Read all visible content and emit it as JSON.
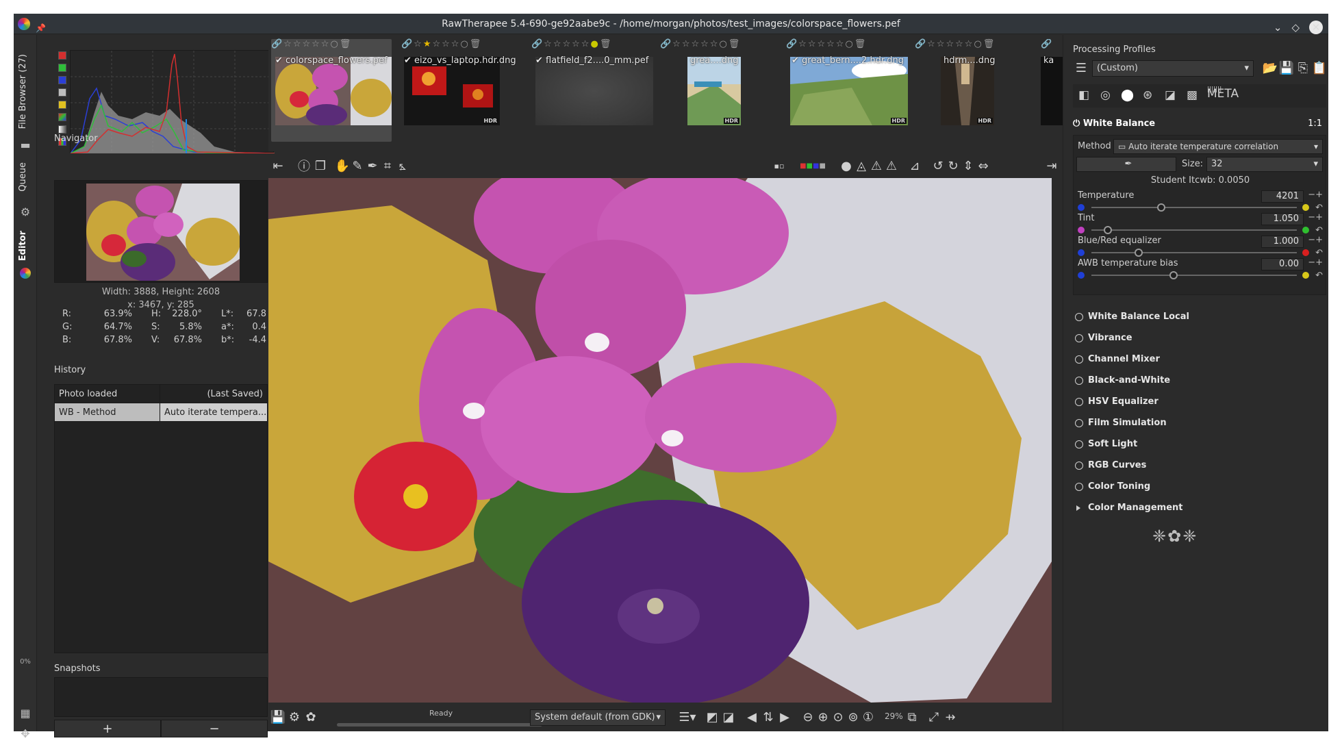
{
  "window": {
    "title": "RawTherapee 5.4-690-ge92aabe9c - /home/morgan/photos/test_images/colorspace_flowers.pef"
  },
  "vtabs": {
    "file_browser": "File Browser (27)",
    "queue": "Queue",
    "editor": "Editor",
    "progress": "0%"
  },
  "navigator": {
    "title": "Navigator",
    "size": "Width: 3888, Height: 2608",
    "coords": "x: 3467, y: 285",
    "stats": [
      {
        "k1": "R:",
        "v1": "63.9%",
        "k2": "H:",
        "v2": "228.0°",
        "k3": "L*:",
        "v3": "67.8"
      },
      {
        "k1": "G:",
        "v1": "64.7%",
        "k2": "S:",
        "v2": "5.8%",
        "k3": "a*:",
        "v3": "0.4"
      },
      {
        "k1": "B:",
        "v1": "67.8%",
        "k2": "V:",
        "v2": "67.8%",
        "k3": "b*:",
        "v3": "-4.4"
      }
    ]
  },
  "history": {
    "title": "History",
    "header": {
      "a": "Photo loaded",
      "b": "(Last Saved)"
    },
    "rows": [
      {
        "a": "WB - Method",
        "b": "Auto iterate tempera..."
      }
    ]
  },
  "snapshots": {
    "title": "Snapshots",
    "add": "+",
    "remove": "−"
  },
  "filmstrip": {
    "items": [
      {
        "name": "colorspace_flowers.pef",
        "hdr": ""
      },
      {
        "name": "eizo_vs_laptop.hdr.dng",
        "hdr": "HDR"
      },
      {
        "name": "flatfield_f2....0_mm.pef",
        "hdr": ""
      },
      {
        "name": "grea....dng",
        "hdr": "HDR"
      },
      {
        "name": "great_bern....2.hdr.dng",
        "hdr": "HDR"
      },
      {
        "name": "hdrm....dng",
        "hdr": "HDR"
      },
      {
        "name": "ka",
        "hdr": ""
      }
    ]
  },
  "bottombar": {
    "status": "Ready",
    "output_profile": "System default (from GDK)",
    "zoom": "29%"
  },
  "right": {
    "title": "Processing Profiles",
    "profile": "(Custom)",
    "wb": {
      "title": "White Balance",
      "ratio": "1:1",
      "method_label": "Method",
      "method_value": "Auto iterate temperature correlation",
      "size_label": "Size:",
      "size_value": "32",
      "student": "Student Itcwb: 0.0050",
      "sliders": [
        {
          "label": "Temperature",
          "value": "4201",
          "pos": 0.34,
          "lcolor": "#1f3fd6",
          "rcolor": "#d8c81a"
        },
        {
          "label": "Tint",
          "value": "1.050",
          "pos": 0.08,
          "lcolor": "#c040c0",
          "rcolor": "#2fbf2f"
        },
        {
          "label": "Blue/Red equalizer",
          "value": "1.000",
          "pos": 0.23,
          "lcolor": "#1f3fd6",
          "rcolor": "#d81f1f"
        },
        {
          "label": "AWB temperature bias",
          "value": "0.00",
          "pos": 0.4,
          "lcolor": "#1f3fd6",
          "rcolor": "#d8c81a"
        }
      ]
    },
    "tools": [
      "White Balance Local",
      "Vibrance",
      "Channel Mixer",
      "Black-and-White",
      "HSV Equalizer",
      "Film Simulation",
      "Soft Light",
      "RGB Curves",
      "Color Toning",
      "Color Management"
    ],
    "icon_meta": "META"
  }
}
